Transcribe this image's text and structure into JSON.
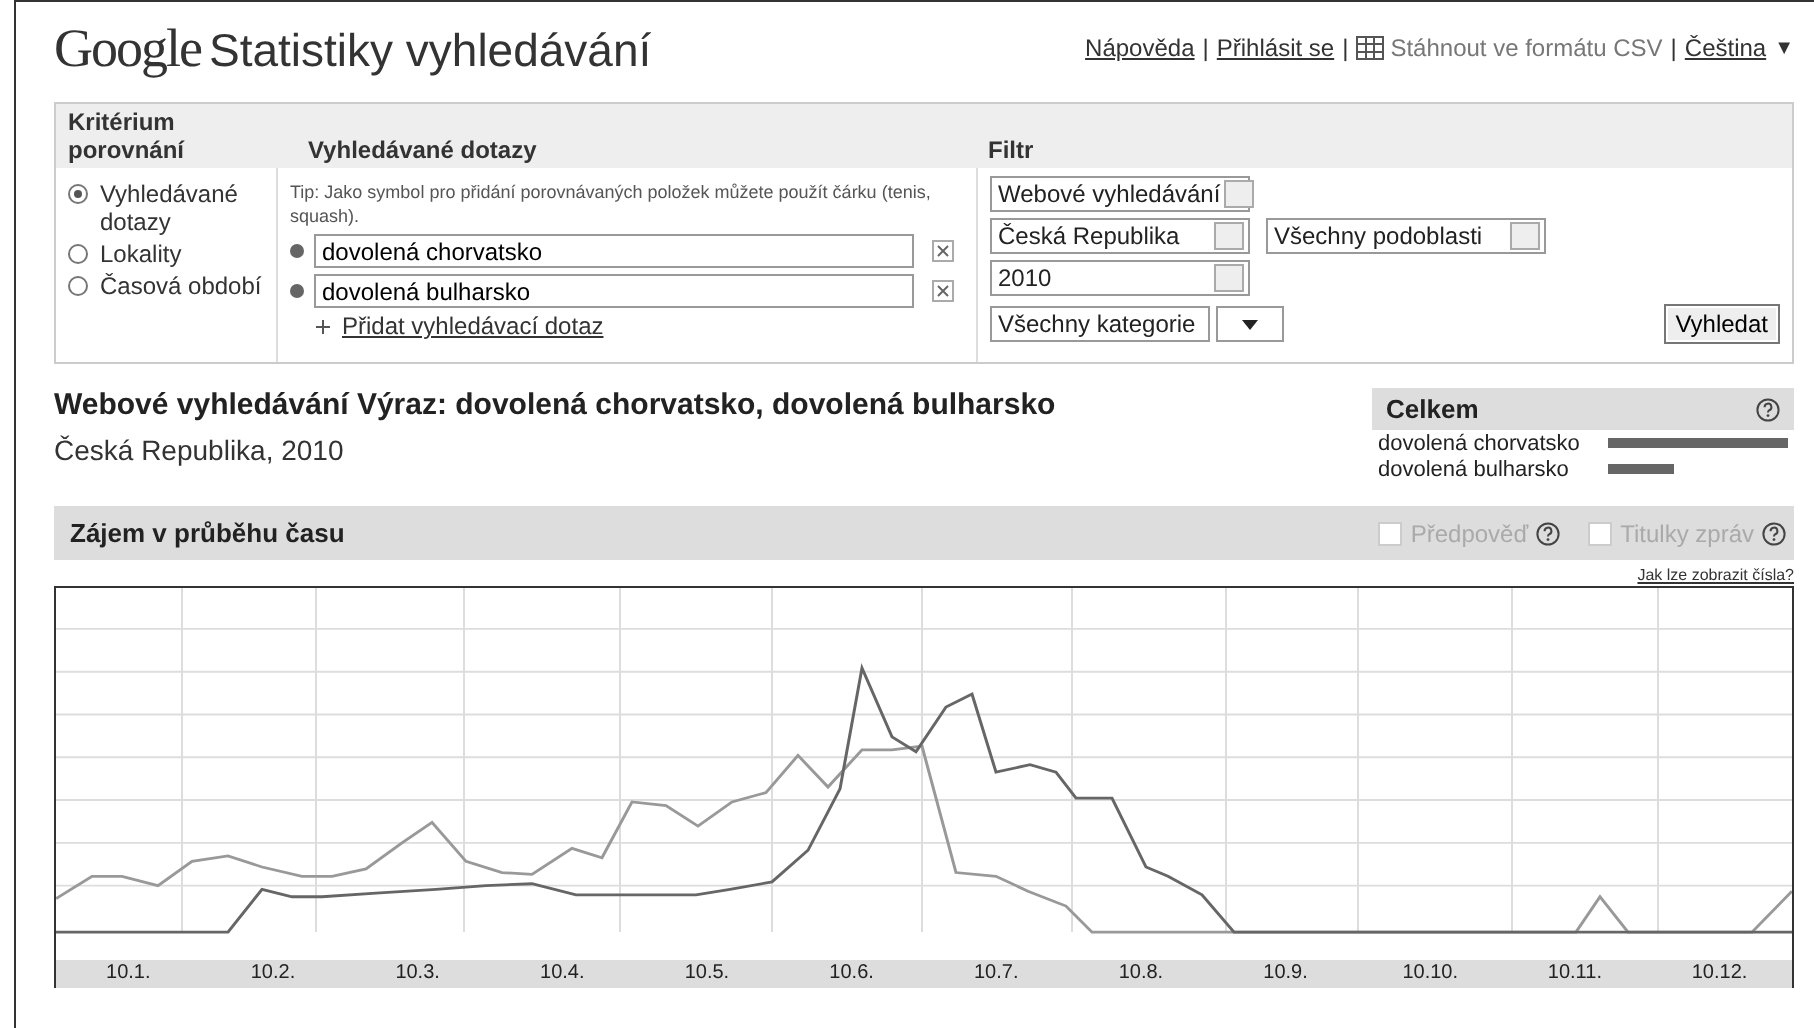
{
  "header": {
    "logo": "Google",
    "title": "Statistiky vyhledávání",
    "links": [
      {
        "kind": "link",
        "label": "Nápověda"
      },
      {
        "kind": "link",
        "label": "Přihlásit se"
      },
      {
        "kind": "csv",
        "label": "Stáhnout ve formátu CSV"
      },
      {
        "kind": "language",
        "label": "Čeština"
      }
    ],
    "language_caret": "▼",
    "separators": [
      "|",
      "|",
      "|"
    ]
  },
  "criteria": {
    "heading": "Kritérium porovnání",
    "options": [
      {
        "label": "Vyhledávané dotazy",
        "selected": true
      },
      {
        "label": "Lokality",
        "selected": false
      },
      {
        "label": "Časová období",
        "selected": false
      }
    ]
  },
  "queries": {
    "heading": "Vyhledávané dotazy",
    "tip": "Tip: Jako symbol pro přidání porovnávaných položek můžete použít čárku (tenis, squash).",
    "terms": [
      {
        "value": "dovolená chorvatsko",
        "color": "#666666"
      },
      {
        "value": "dovolená bulharsko",
        "color": "#666666"
      }
    ],
    "add_link": "Přidat vyhledávací dotaz"
  },
  "filter": {
    "heading": "Filtr",
    "selects": [
      {
        "value": "Webové vyhledávání"
      },
      {
        "value": "Česká Republika"
      },
      {
        "value": "Všechny podoblasti"
      },
      {
        "value": "2010"
      }
    ],
    "category": "Všechny kategorie",
    "search_button": "Vyhledat"
  },
  "result": {
    "title": "Webové vyhledávání Výraz: dovolená chorvatsko, dovolená bulharsko",
    "subtitle": "Česká Republika, 2010"
  },
  "totals": {
    "heading": "Celkem",
    "items": [
      {
        "label": "dovolená chorvatsko"
      },
      {
        "label": "dovolená bulharsko"
      }
    ]
  },
  "interest": {
    "heading": "Zájem v průběhu času",
    "toggles": [
      {
        "label": "Předpověď",
        "checked": false
      },
      {
        "label": "Titulky zpráv",
        "checked": false
      }
    ],
    "numbers_link": "Jak lze zobrazit čísla?",
    "x_labels": [
      "10.1.",
      "10.2.",
      "10.3.",
      "10.4.",
      "10.5.",
      "10.6.",
      "10.7.",
      "10.8.",
      "10.9.",
      "10.10.",
      "10.11.",
      "10.12."
    ]
  }
}
